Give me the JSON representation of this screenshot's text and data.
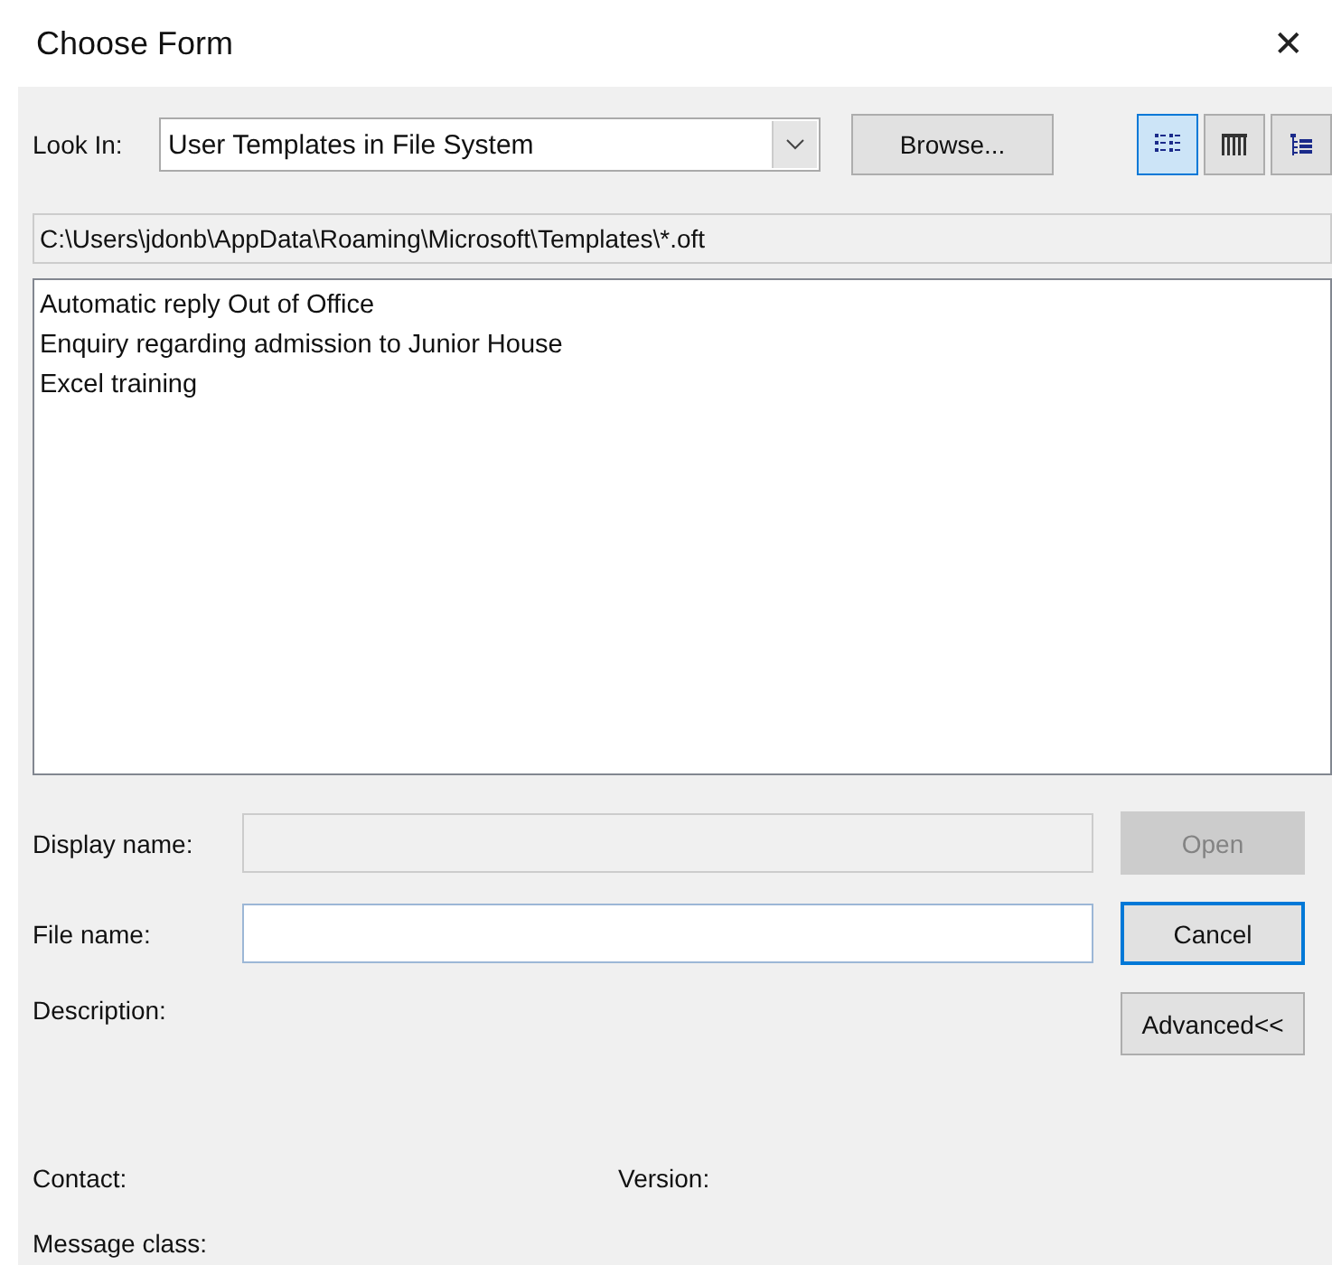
{
  "window": {
    "title": "Choose Form",
    "close": "✕"
  },
  "look_in": {
    "label": "Look In:",
    "value": "User Templates in File System"
  },
  "browse_button": {
    "label": "Browse..."
  },
  "view_buttons": [
    {
      "kind": "list",
      "selected": true
    },
    {
      "kind": "details",
      "selected": false
    },
    {
      "kind": "tree",
      "selected": false
    }
  ],
  "path": "C:\\Users\\jdonb\\AppData\\Roaming\\Microsoft\\Templates\\*.oft",
  "forms": [
    "Automatic reply Out of Office",
    "Enquiry regarding admission to Junior House",
    "Excel training"
  ],
  "display_name": {
    "label": "Display name:",
    "disabled": true
  },
  "file_name": {
    "label": "File name:"
  },
  "buttons": [
    {
      "label": "Open",
      "disabled": true,
      "default": false
    },
    {
      "label": "Cancel",
      "disabled": false,
      "default": true
    },
    {
      "label": "Advanced<<",
      "disabled": false,
      "default": false
    }
  ],
  "description": {
    "label": "Description:"
  },
  "contact": {
    "label": "Contact:"
  },
  "version": {
    "label": "Version:"
  },
  "message_class": {
    "label": "Message class:"
  }
}
